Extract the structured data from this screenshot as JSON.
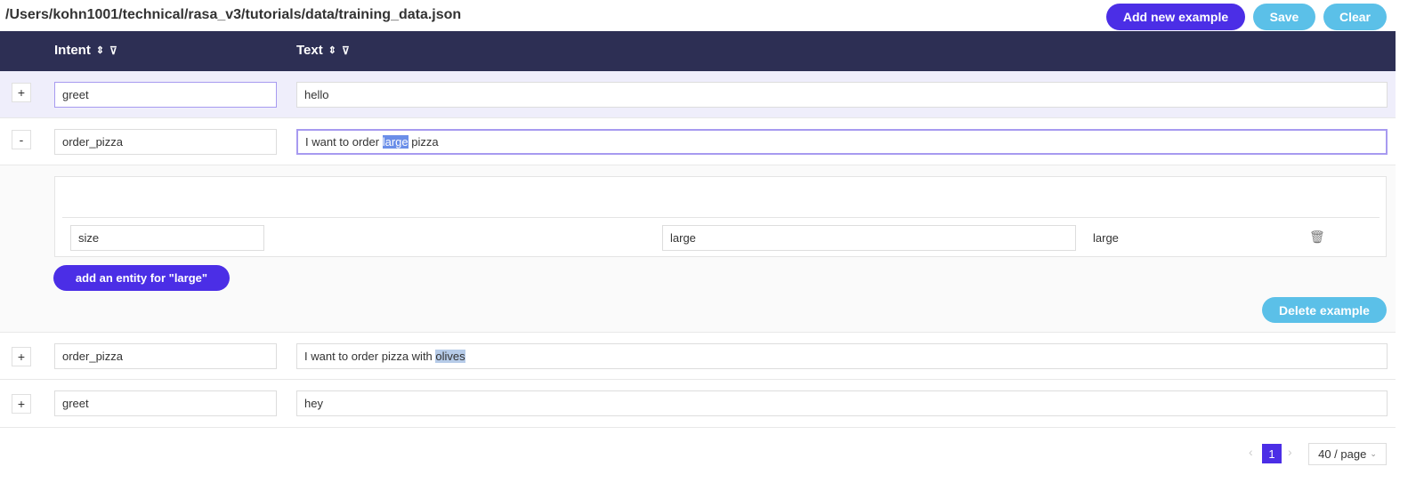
{
  "file_path": "/Users/kohn1001/technical/rasa_v3/tutorials/data/training_data.json",
  "toolbar": {
    "add": "Add new example",
    "save": "Save",
    "clear": "Clear"
  },
  "columns": {
    "intent": "Intent",
    "text": "Text",
    "sort_icon": "⇕",
    "filter_icon": "⊽"
  },
  "rows": [
    {
      "toggle": "+",
      "intent": "greet",
      "text": "hello"
    },
    {
      "toggle": "-",
      "intent": "order_pizza",
      "text_before": "I want to order ",
      "text_entity": "large",
      "text_after": " pizza"
    },
    {
      "toggle": "+",
      "intent": "order_pizza",
      "text_before": "I want to order pizza with ",
      "text_entity": "olives"
    },
    {
      "toggle": "+",
      "intent": "greet",
      "text": "hey"
    }
  ],
  "entity": {
    "name": "size",
    "value": "large",
    "text": "large",
    "add_button": "add an entity for \"large\"",
    "delete_example": "Delete example"
  },
  "pagination": {
    "prev": "‹",
    "page": "1",
    "next": "›",
    "page_size": "40 / page"
  },
  "colors": {
    "header": "#2d2f54",
    "primary": "#4b2ee6",
    "secondary": "#5bc0e8"
  }
}
